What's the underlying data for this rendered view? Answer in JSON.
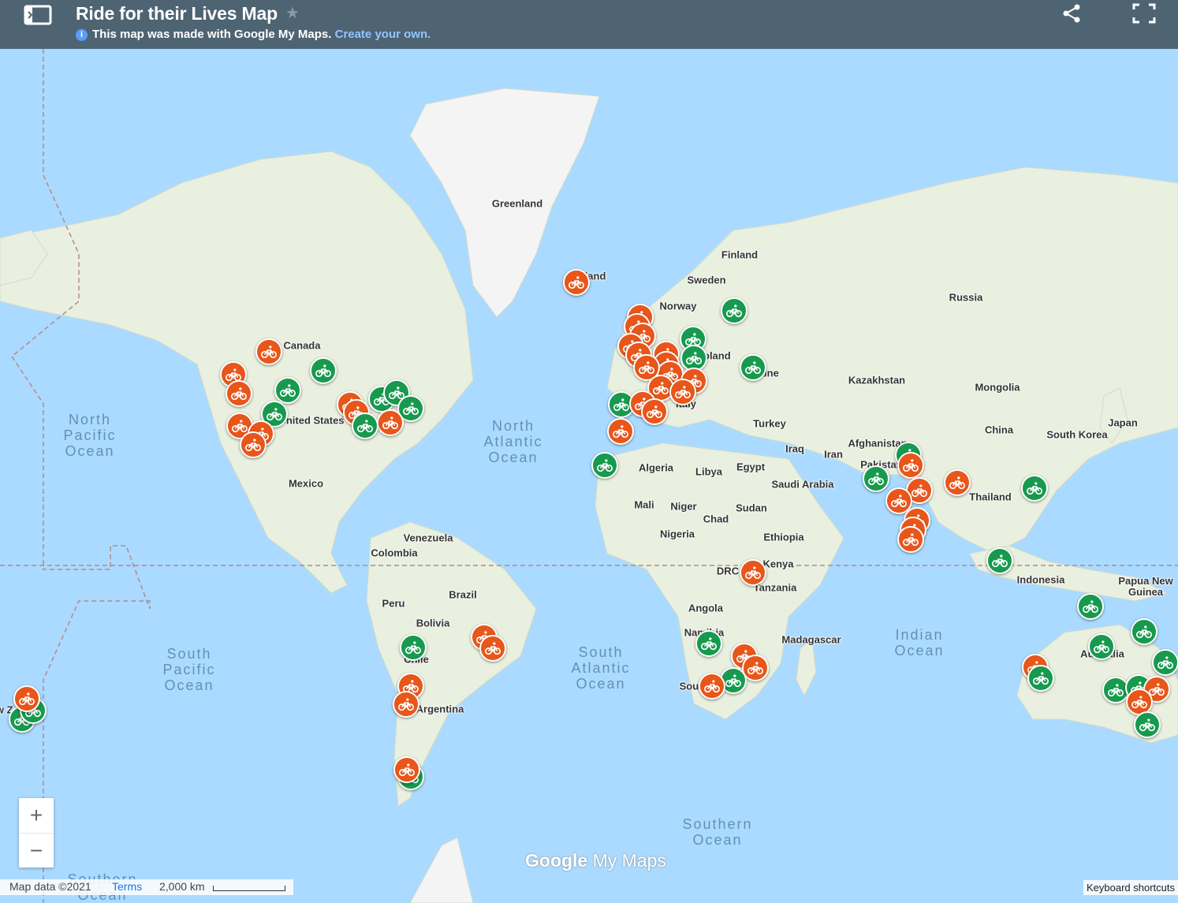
{
  "header": {
    "title": "Ride for their Lives Map",
    "subline": "This map was made with Google My Maps.",
    "create_link": "Create your own.",
    "info_icon": "i"
  },
  "colors": {
    "orange": "#e8561a",
    "green": "#179a4e",
    "header": "#4e6473",
    "ocean": "#aadaff",
    "land": "#e9f0df"
  },
  "map": {
    "labels": {
      "greenland": "Greenland",
      "iceland": "Iceland",
      "finland": "Finland",
      "sweden": "Sweden",
      "norway": "Norway",
      "russia": "Russia",
      "canada": "Canada",
      "united_states": "United States",
      "mexico": "Mexico",
      "kazakhstan": "Kazakhstan",
      "mongolia": "Mongolia",
      "china": "China",
      "japan": "Japan",
      "south_korea": "South Korea",
      "turkey": "Turkey",
      "iraq": "Iraq",
      "iran": "Iran",
      "afghanistan": "Afghanistan",
      "pakistan": "Pakistan",
      "saudi_arabia": "Saudi Arabia",
      "egypt": "Egypt",
      "libya": "Libya",
      "algeria": "Algeria",
      "mali": "Mali",
      "niger": "Niger",
      "chad": "Chad",
      "sudan": "Sudan",
      "nigeria": "Nigeria",
      "ethiopia": "Ethiopia",
      "kenya": "Kenya",
      "drc": "DRC",
      "tanzania": "Tanzania",
      "angola": "Angola",
      "namibia": "Namibia",
      "madagascar": "Madagascar",
      "thailand": "Thailand",
      "indonesia": "Indonesia",
      "papua": "Papua New\nGuinea",
      "australia": "Australia",
      "venezuela": "Venezuela",
      "colombia": "Colombia",
      "peru": "Peru",
      "brazil": "Brazil",
      "bolivia": "Bolivia",
      "chile": "Chile",
      "argentina": "Argentina",
      "poland": "Poland",
      "ukraine": "Ukraine",
      "italy": "Italy",
      "south_africa": "South Africa",
      "new_zealand": "New Zealand"
    },
    "oceans": {
      "north_pacific": "North\nPacific\nOcean",
      "north_atlantic": "North\nAtlantic\nOcean",
      "south_pacific": "South\nPacific\nOcean",
      "south_atlantic": "South\nAtlantic\nOcean",
      "indian": "Indian\nOcean",
      "southern": "Southern\nOcean",
      "southern_bottom": "Southern\nOcean"
    }
  },
  "markers": [
    {
      "name": "iceland",
      "color": "orange"
    },
    {
      "name": "finland",
      "color": "green"
    },
    {
      "name": "poland",
      "color": "green"
    },
    {
      "name": "ukraine",
      "color": "green"
    },
    {
      "name": "uk-1",
      "color": "orange"
    },
    {
      "name": "uk-2",
      "color": "orange"
    },
    {
      "name": "uk-3",
      "color": "orange"
    },
    {
      "name": "uk-4",
      "color": "orange"
    },
    {
      "name": "uk-5",
      "color": "orange"
    },
    {
      "name": "netherlands",
      "color": "orange"
    },
    {
      "name": "germany-1",
      "color": "orange"
    },
    {
      "name": "germany-2",
      "color": "green"
    },
    {
      "name": "germany-3",
      "color": "orange"
    },
    {
      "name": "switzerland",
      "color": "orange"
    },
    {
      "name": "france-1",
      "color": "orange"
    },
    {
      "name": "france-2",
      "color": "orange"
    },
    {
      "name": "italy",
      "color": "orange"
    },
    {
      "name": "portugal",
      "color": "green"
    },
    {
      "name": "spain-1",
      "color": "orange"
    },
    {
      "name": "spain-2",
      "color": "orange"
    },
    {
      "name": "spain-3",
      "color": "orange"
    },
    {
      "name": "morocco",
      "color": "green"
    },
    {
      "name": "canada-west",
      "color": "orange"
    },
    {
      "name": "canada-central",
      "color": "green"
    },
    {
      "name": "usa-nw-1",
      "color": "orange"
    },
    {
      "name": "usa-nw-2",
      "color": "orange"
    },
    {
      "name": "usa-mid-1",
      "color": "green"
    },
    {
      "name": "usa-mid-2",
      "color": "green"
    },
    {
      "name": "usa-ca-1",
      "color": "orange"
    },
    {
      "name": "usa-ca-2",
      "color": "orange"
    },
    {
      "name": "usa-ca-3",
      "color": "orange"
    },
    {
      "name": "usa-chicago",
      "color": "orange"
    },
    {
      "name": "usa-detroit",
      "color": "orange"
    },
    {
      "name": "usa-east-1",
      "color": "green"
    },
    {
      "name": "usa-east-2",
      "color": "green"
    },
    {
      "name": "usa-east-3",
      "color": "green"
    },
    {
      "name": "usa-east-4",
      "color": "orange"
    },
    {
      "name": "usa-east-5",
      "color": "green"
    },
    {
      "name": "pakistan",
      "color": "green"
    },
    {
      "name": "india-north",
      "color": "orange"
    },
    {
      "name": "india-west",
      "color": "green"
    },
    {
      "name": "india-1",
      "color": "orange"
    },
    {
      "name": "india-2",
      "color": "orange"
    },
    {
      "name": "india-3",
      "color": "orange"
    },
    {
      "name": "india-4",
      "color": "orange"
    },
    {
      "name": "india-5",
      "color": "orange"
    },
    {
      "name": "bangladesh",
      "color": "orange"
    },
    {
      "name": "vietnam",
      "color": "green"
    },
    {
      "name": "indonesia",
      "color": "green"
    },
    {
      "name": "australia-ne",
      "color": "green"
    },
    {
      "name": "australia-center",
      "color": "green"
    },
    {
      "name": "australia-east-1",
      "color": "green"
    },
    {
      "name": "australia-east-2",
      "color": "green"
    },
    {
      "name": "australia-se-1",
      "color": "green"
    },
    {
      "name": "australia-se-2",
      "color": "green"
    },
    {
      "name": "australia-se-3",
      "color": "orange"
    },
    {
      "name": "australia-se-4",
      "color": "orange"
    },
    {
      "name": "australia-se-5",
      "color": "green"
    },
    {
      "name": "australia-west-1",
      "color": "orange"
    },
    {
      "name": "australia-west-2",
      "color": "green"
    },
    {
      "name": "kenya",
      "color": "orange"
    },
    {
      "name": "namibia",
      "color": "green"
    },
    {
      "name": "south-africa-1",
      "color": "orange"
    },
    {
      "name": "south-africa-2",
      "color": "orange"
    },
    {
      "name": "south-africa-3",
      "color": "green"
    },
    {
      "name": "south-africa-4",
      "color": "orange"
    },
    {
      "name": "chile-north",
      "color": "green"
    },
    {
      "name": "chile-1",
      "color": "orange"
    },
    {
      "name": "chile-2",
      "color": "orange"
    },
    {
      "name": "brazil-1",
      "color": "orange"
    },
    {
      "name": "brazil-2",
      "color": "orange"
    },
    {
      "name": "patagonia-1",
      "color": "green"
    },
    {
      "name": "patagonia-2",
      "color": "orange"
    },
    {
      "name": "nz-1",
      "color": "green"
    },
    {
      "name": "nz-2",
      "color": "green"
    },
    {
      "name": "nz-3",
      "color": "orange"
    }
  ],
  "controls": {
    "zoom_in": "+",
    "zoom_out": "−"
  },
  "footer": {
    "map_data": "Map data ©2021",
    "terms": "Terms",
    "scale": "2,000 km",
    "keyboard": "Keyboard shortcuts",
    "brand_google": "Google",
    "brand_mymaps": "My Maps"
  }
}
